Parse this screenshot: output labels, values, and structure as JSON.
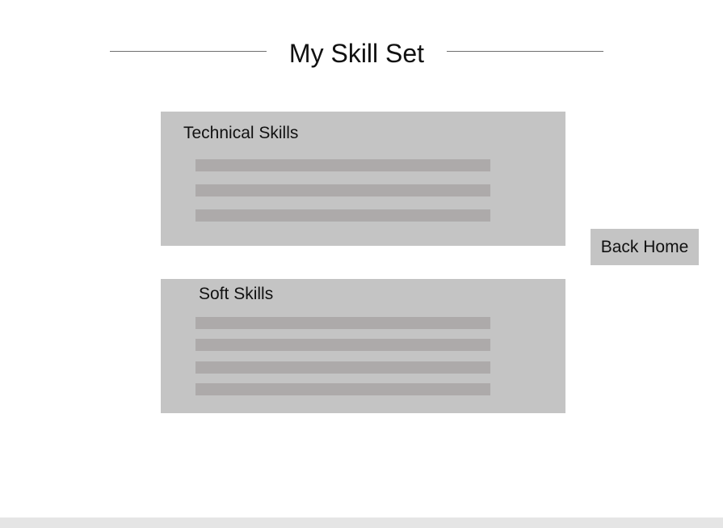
{
  "page": {
    "title": "My Skill Set"
  },
  "sections": {
    "technical": {
      "title": "Technical Skills",
      "placeholder_item_count": 3
    },
    "soft": {
      "title": "Soft Skills",
      "placeholder_item_count": 4
    }
  },
  "nav": {
    "back_home_label": "Back Home"
  },
  "colors": {
    "card_background": "#c4c4c4",
    "placeholder_bar": "#adaaaa",
    "title_line": "#6f6f6f",
    "footer_strip": "#e5e5e5"
  }
}
